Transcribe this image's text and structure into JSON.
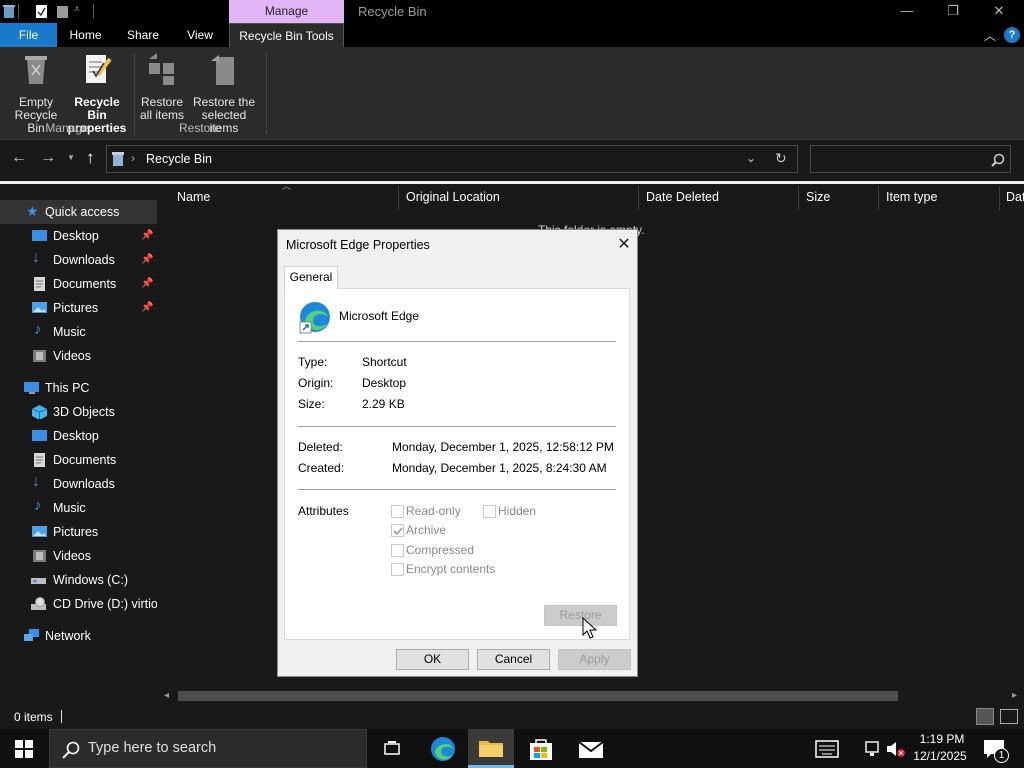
{
  "titlebar": {
    "context_tab": "Manage",
    "title": "Recycle Bin",
    "minimize": "—",
    "restore": "❐",
    "close": "✕"
  },
  "tabs": {
    "file": "File",
    "home": "Home",
    "share": "Share",
    "view": "View",
    "tools": "Recycle Bin Tools"
  },
  "ribbon": {
    "empty": [
      "Empty",
      "Recycle Bin"
    ],
    "properties": [
      "Recycle Bin",
      "properties"
    ],
    "restore_all": [
      "Restore",
      "all items"
    ],
    "restore_selected": [
      "Restore the",
      "selected items"
    ],
    "group_manage": "Manage",
    "group_restore": "Restore"
  },
  "address": {
    "path": "Recycle Bin"
  },
  "nav": {
    "quick_access": "Quick access",
    "quick": [
      "Desktop",
      "Downloads",
      "Documents",
      "Pictures",
      "Music",
      "Videos"
    ],
    "this_pc": "This PC",
    "pc": [
      "3D Objects",
      "Desktop",
      "Documents",
      "Downloads",
      "Music",
      "Pictures",
      "Videos",
      "Windows (C:)",
      "CD Drive (D:) virtio-"
    ],
    "network": "Network"
  },
  "columns": [
    "Name",
    "Original Location",
    "Date Deleted",
    "Size",
    "Item type",
    "Dat"
  ],
  "empty_text": "This folder is empty.",
  "status": {
    "items": "0 items"
  },
  "taskbar": {
    "search_placeholder": "Type here to search",
    "time": "1:19 PM",
    "date": "12/1/2025",
    "notif_count": "1"
  },
  "dialog": {
    "title": "Microsoft Edge Properties",
    "close": "✕",
    "tab": "General",
    "file_name": "Microsoft Edge",
    "type_label": "Type:",
    "type_value": "Shortcut",
    "origin_label": "Origin:",
    "origin_value": "Desktop",
    "size_label": "Size:",
    "size_value": "2.29 KB",
    "deleted_label": "Deleted:",
    "deleted_value": "Monday, December 1, 2025, 12:58:12 PM",
    "created_label": "Created:",
    "created_value": "Monday, December 1, 2025, 8:24:30 AM",
    "attributes_label": "Attributes",
    "readonly": "Read-only",
    "hidden": "Hidden",
    "archive": "Archive",
    "compressed": "Compressed",
    "encrypt": "Encrypt contents",
    "restore": "Restore",
    "ok": "OK",
    "cancel": "Cancel",
    "apply": "Apply"
  },
  "colors": {
    "accent": "#1979ca",
    "context": "#e1b5f6",
    "folder": "#e8b84a"
  }
}
